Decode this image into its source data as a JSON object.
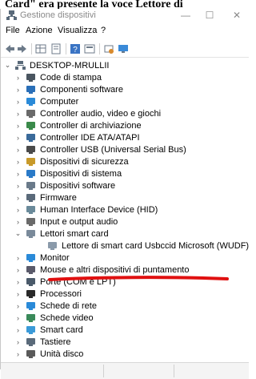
{
  "caption": {
    "text": "Card\" era presente la voce Lettore di"
  },
  "window": {
    "title": "Gestione dispositivi",
    "controls": {
      "minimize": "—",
      "maximize": "☐",
      "close": "✕"
    }
  },
  "menu": [
    "File",
    "Azione",
    "Visualizza",
    "?"
  ],
  "tree": {
    "root": "DESKTOP-MRULLII",
    "categories": [
      {
        "label": "Code di stampa",
        "expanded": false,
        "icon": "printer-icon"
      },
      {
        "label": "Componenti software",
        "expanded": false,
        "icon": "puzzle-icon"
      },
      {
        "label": "Computer",
        "expanded": false,
        "icon": "monitor-icon"
      },
      {
        "label": "Controller audio, video e giochi",
        "expanded": false,
        "icon": "speaker-icon"
      },
      {
        "label": "Controller di archiviazione",
        "expanded": false,
        "icon": "storage-icon"
      },
      {
        "label": "Controller IDE ATA/ATAPI",
        "expanded": false,
        "icon": "ide-icon"
      },
      {
        "label": "Controller USB (Universal Serial Bus)",
        "expanded": false,
        "icon": "usb-icon"
      },
      {
        "label": "Dispositivi di sicurezza",
        "expanded": false,
        "icon": "security-key-icon"
      },
      {
        "label": "Dispositivi di sistema",
        "expanded": false,
        "icon": "system-folder-icon"
      },
      {
        "label": "Dispositivi software",
        "expanded": false,
        "icon": "software-device-icon"
      },
      {
        "label": "Firmware",
        "expanded": false,
        "icon": "firmware-icon"
      },
      {
        "label": "Human Interface Device (HID)",
        "expanded": false,
        "icon": "hid-icon"
      },
      {
        "label": "Input e output audio",
        "expanded": false,
        "icon": "audio-io-icon"
      },
      {
        "label": "Lettori smart card",
        "expanded": true,
        "icon": "smartcard-reader-icon"
      },
      {
        "label": "Lettore di smart card Usbccid Microsoft (WUDF)",
        "child": true,
        "icon": "smartcard-device-icon"
      },
      {
        "label": "Monitor",
        "expanded": false,
        "icon": "monitor-icon"
      },
      {
        "label": "Mouse e altri dispositivi di puntamento",
        "expanded": false,
        "icon": "mouse-icon"
      },
      {
        "label": "Porte (COM e LPT)",
        "expanded": false,
        "icon": "port-icon"
      },
      {
        "label": "Processori",
        "expanded": false,
        "icon": "cpu-icon"
      },
      {
        "label": "Schede di rete",
        "expanded": false,
        "icon": "network-icon"
      },
      {
        "label": "Schede video",
        "expanded": false,
        "icon": "display-adapter-icon"
      },
      {
        "label": "Smart card",
        "expanded": false,
        "icon": "smartcard-icon"
      },
      {
        "label": "Tastiere",
        "expanded": false,
        "icon": "keyboard-icon"
      },
      {
        "label": "Unità disco",
        "expanded": false,
        "icon": "disk-drive-icon"
      }
    ]
  },
  "colors": {
    "annotation": "#e01010",
    "selection": "#cce8ff"
  }
}
